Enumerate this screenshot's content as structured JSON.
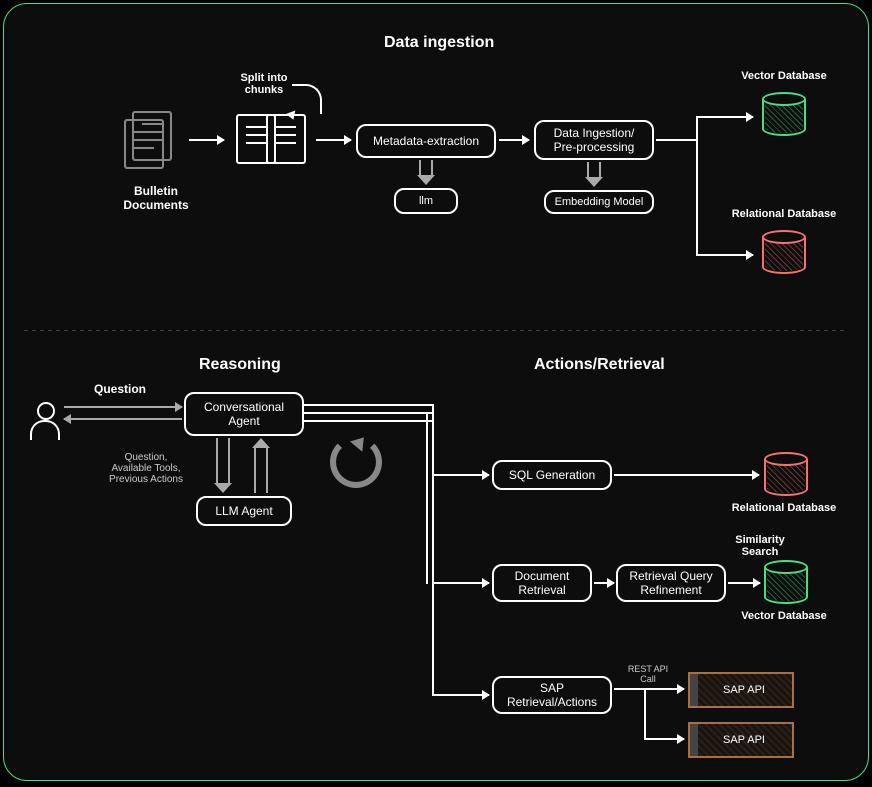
{
  "section_ingestion_title": "Data ingestion",
  "bulletin_label": "Bulletin\nDocuments",
  "split_label": "Split into\nchunks",
  "meta_box": "Metadata-extraction",
  "dataing_box": "Data Ingestion/\nPre-processing",
  "llm_box": "llm",
  "embed_box": "Embedding Model",
  "vector_db_label": "Vector Database",
  "relational_db_label": "Relational Database",
  "reasoning_title": "Reasoning",
  "actions_title": "Actions/Retrieval",
  "question_label": "Question",
  "conv_agent": "Conversational\nAgent",
  "llm_agent": "LLM Agent",
  "qap_label": "Question,\nAvailable Tools,\nPrevious Actions",
  "sql_gen": "SQL Generation",
  "doc_retr": "Document\nRetrieval",
  "rqr": "Retrieval Query\nRefinement",
  "sim_search": "Similarity\nSearch",
  "sap_ra": "SAP\nRetrieval/Actions",
  "rest_call": "REST API\nCall",
  "sap_api": "SAP API",
  "vector_db_label2": "Vector Database",
  "relational_db_label2": "Relational Database"
}
